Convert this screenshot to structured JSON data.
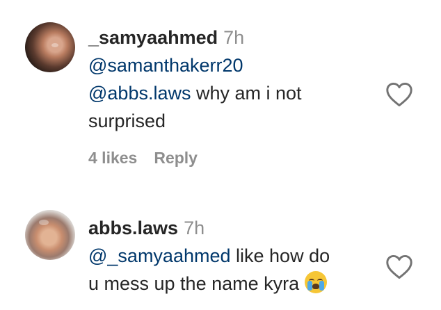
{
  "comments": [
    {
      "username": "_samyaahmed",
      "time": "7h",
      "text_lines": [
        {
          "mention": "@samanthakerr20",
          "text": ""
        },
        {
          "mention": "@abbs.laws",
          "text": " why am i not"
        },
        {
          "mention": "",
          "text": "surprised"
        }
      ],
      "likes": "4 likes",
      "reply": "Reply",
      "avatar_icon": "profile-photo",
      "like_icon": "heart-outline-icon"
    },
    {
      "username": "abbs.laws",
      "time": "7h",
      "text_lines": [
        {
          "mention": "@_samyaahmed",
          "text": " like how do"
        },
        {
          "mention": "",
          "text": "u mess up the name kyra "
        }
      ],
      "emoji": "loudly-crying-face",
      "avatar_icon": "profile-photo",
      "like_icon": "heart-outline-icon"
    }
  ],
  "colors": {
    "username": "#262626",
    "mention": "#00376b",
    "secondary": "#8e8e8e",
    "background": "#ffffff"
  }
}
